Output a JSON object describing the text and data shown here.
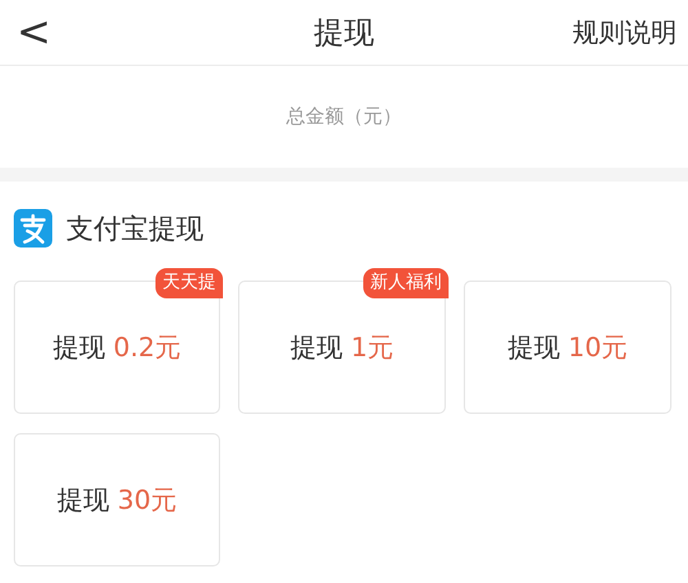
{
  "header": {
    "back": "<",
    "title": "提现",
    "rules_link": "规则说明"
  },
  "total": {
    "label": "总金额（元）"
  },
  "section": {
    "title": "支付宝提现"
  },
  "options": [
    {
      "label": "提现",
      "amount": "0.2元",
      "badge": "天天提"
    },
    {
      "label": "提现",
      "amount": "1元",
      "badge": "新人福利"
    },
    {
      "label": "提现",
      "amount": "10元"
    },
    {
      "label": "提现",
      "amount": "30元"
    }
  ]
}
